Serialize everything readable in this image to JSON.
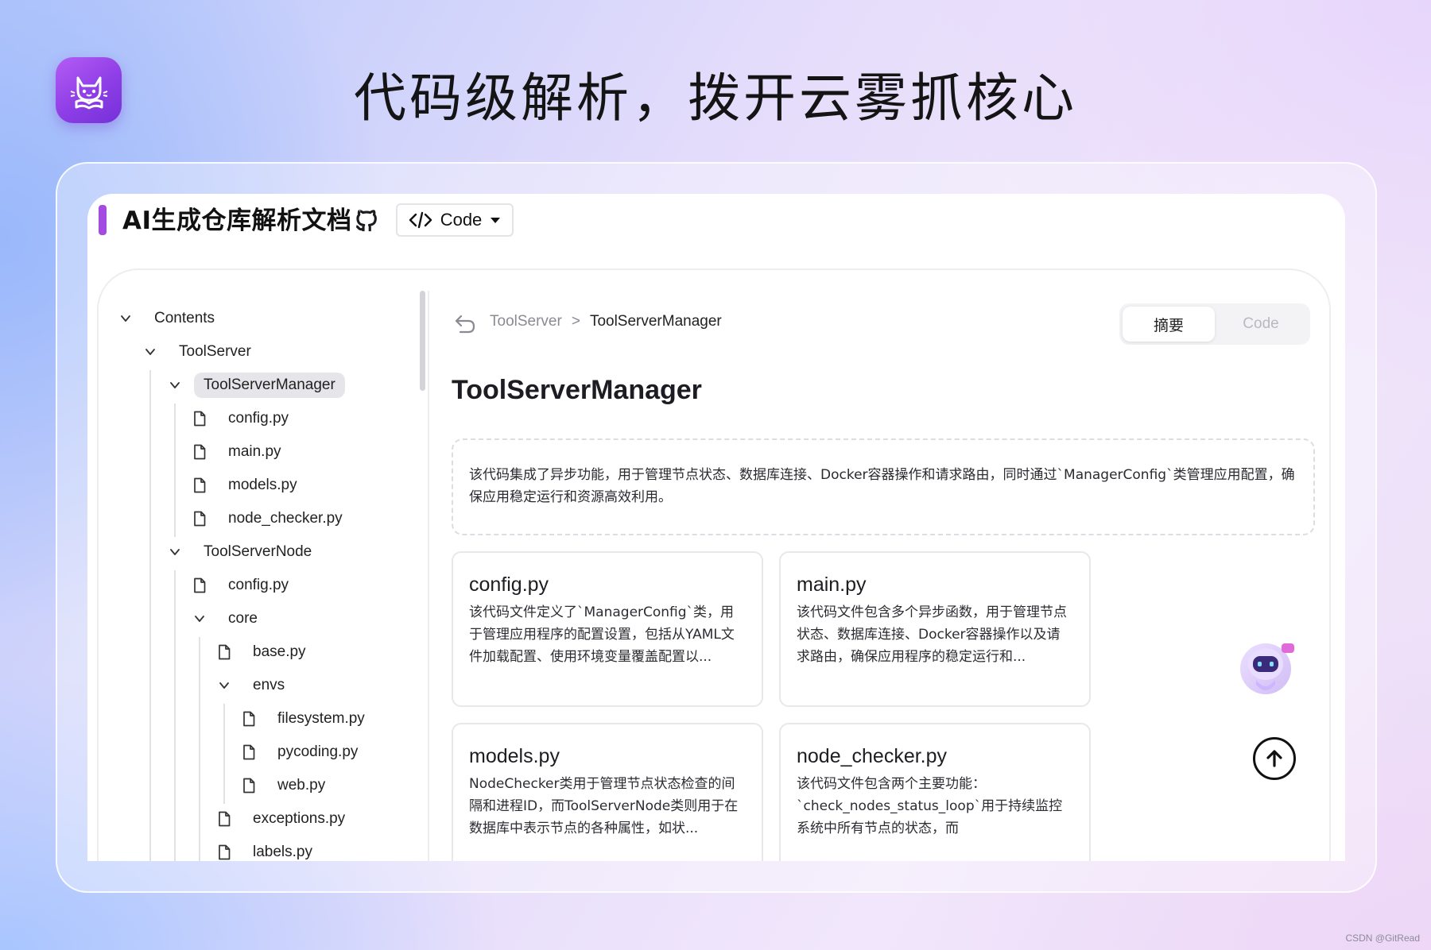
{
  "headline": "代码级解析，拨开云雾抓核心",
  "app_logo_icon": "cat-book-icon",
  "header": {
    "title": "AI生成仓库解析文档",
    "github_icon": "github-icon",
    "code_button_label": "Code",
    "accent_color": "#a34ce0"
  },
  "sidebar": {
    "items": [
      {
        "label": "Contents",
        "type": "folder",
        "depth": 0
      },
      {
        "label": "ToolServer",
        "type": "folder",
        "depth": 1
      },
      {
        "label": "ToolServerManager",
        "type": "folder",
        "depth": 2,
        "selected": true
      },
      {
        "label": "config.py",
        "type": "file",
        "depth": 3
      },
      {
        "label": "main.py",
        "type": "file",
        "depth": 3
      },
      {
        "label": "models.py",
        "type": "file",
        "depth": 3
      },
      {
        "label": "node_checker.py",
        "type": "file",
        "depth": 3
      },
      {
        "label": "ToolServerNode",
        "type": "folder",
        "depth": 2
      },
      {
        "label": "config.py",
        "type": "file",
        "depth": 3
      },
      {
        "label": "core",
        "type": "folder",
        "depth": 3
      },
      {
        "label": "base.py",
        "type": "file",
        "depth": 4
      },
      {
        "label": "envs",
        "type": "folder",
        "depth": 4
      },
      {
        "label": "filesystem.py",
        "type": "file",
        "depth": 5
      },
      {
        "label": "pycoding.py",
        "type": "file",
        "depth": 5
      },
      {
        "label": "web.py",
        "type": "file",
        "depth": 5
      },
      {
        "label": "exceptions.py",
        "type": "file",
        "depth": 4
      },
      {
        "label": "labels.py",
        "type": "file",
        "depth": 4
      }
    ]
  },
  "breadcrumb": {
    "parent": "ToolServer",
    "separator": ">",
    "current": "ToolServerManager"
  },
  "view_tabs": {
    "summary": "摘要",
    "code": "Code"
  },
  "page_title": "ToolServerManager",
  "summary": "该代码集成了异步功能，用于管理节点状态、数据库连接、Docker容器操作和请求路由，同时通过`ManagerConfig`类管理应用配置，确保应用稳定运行和资源高效利用。",
  "files": [
    {
      "name": "config.py",
      "desc": "该代码文件定义了`ManagerConfig`类，用于管理应用程序的配置设置，包括从YAML文件加载配置、使用环境变量覆盖配置以..."
    },
    {
      "name": "main.py",
      "desc": "该代码文件包含多个异步函数，用于管理节点状态、数据库连接、Docker容器操作以及请求路由，确保应用程序的稳定运行和..."
    },
    {
      "name": "models.py",
      "desc": "NodeChecker类用于管理节点状态检查的间隔和进程ID，而ToolServerNode类则用于在数据库中表示节点的各种属性，如状..."
    },
    {
      "name": "node_checker.py",
      "desc": "该代码文件包含两个主要功能：`check_nodes_status_loop`用于持续监控系统中所有节点的状态，而`check_nodes_status`..."
    }
  ],
  "assistant_icon": "robot-assistant-icon",
  "scroll_top_icon": "arrow-up-icon",
  "watermark": "CSDN @GitRead"
}
